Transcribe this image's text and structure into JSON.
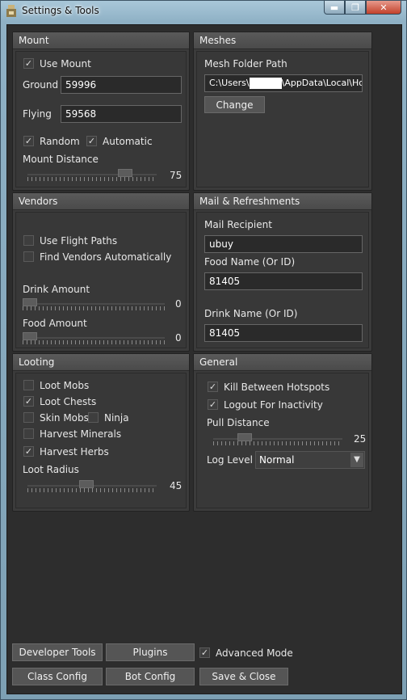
{
  "window": {
    "title": "Settings & Tools",
    "minimize": "▬",
    "maximize": "❐",
    "close": "✕"
  },
  "mount": {
    "header": "Mount",
    "use_mount": "Use Mount",
    "use_mount_checked": true,
    "ground_label": "Ground",
    "ground_value": "59996",
    "flying_label": "Flying",
    "flying_value": "59568",
    "random": "Random",
    "random_checked": true,
    "automatic": "Automatic",
    "automatic_checked": true,
    "distance_label": "Mount Distance",
    "distance_value": "75"
  },
  "meshes": {
    "header": "Meshes",
    "folder_label": "Mesh Folder Path",
    "path_start": "C:\\Users\\",
    "path_end": "\\AppData\\Local\\Hon",
    "change_button": "Change"
  },
  "vendors": {
    "header": "Vendors",
    "flight_paths": "Use Flight Paths",
    "flight_paths_checked": false,
    "find_vendors": "Find Vendors Automatically",
    "find_vendors_checked": false,
    "drink_label": "Drink Amount",
    "drink_value": "0",
    "food_label": "Food Amount",
    "food_value": "0"
  },
  "mail": {
    "header": "Mail & Refreshments",
    "recipient_label": "Mail Recipient",
    "recipient_value": "ubuy",
    "food_label": "Food Name (Or ID)",
    "food_value": "81405",
    "drink_label": "Drink Name (Or ID)",
    "drink_value": "81405"
  },
  "looting": {
    "header": "Looting",
    "loot_mobs": "Loot Mobs",
    "loot_mobs_checked": false,
    "loot_chests": "Loot Chests",
    "loot_chests_checked": true,
    "skin_mobs": "Skin Mobs",
    "skin_mobs_checked": false,
    "ninja": "Ninja",
    "ninja_checked": false,
    "harvest_minerals": "Harvest Minerals",
    "harvest_minerals_checked": false,
    "harvest_herbs": "Harvest Herbs",
    "harvest_herbs_checked": true,
    "radius_label": "Loot Radius",
    "radius_value": "45"
  },
  "general": {
    "header": "General",
    "kill_between": "Kill Between Hotspots",
    "kill_between_checked": true,
    "logout": "Logout For Inactivity",
    "logout_checked": true,
    "pull_label": "Pull Distance",
    "pull_value": "25",
    "log_level_label": "Log Level",
    "log_level_value": "Normal"
  },
  "footer": {
    "developer_tools": "Developer Tools",
    "plugins": "Plugins",
    "advanced_mode": "Advanced Mode",
    "advanced_mode_checked": true,
    "class_config": "Class Config",
    "bot_config": "Bot Config",
    "save_close": "Save & Close"
  },
  "check_glyph": "✓"
}
